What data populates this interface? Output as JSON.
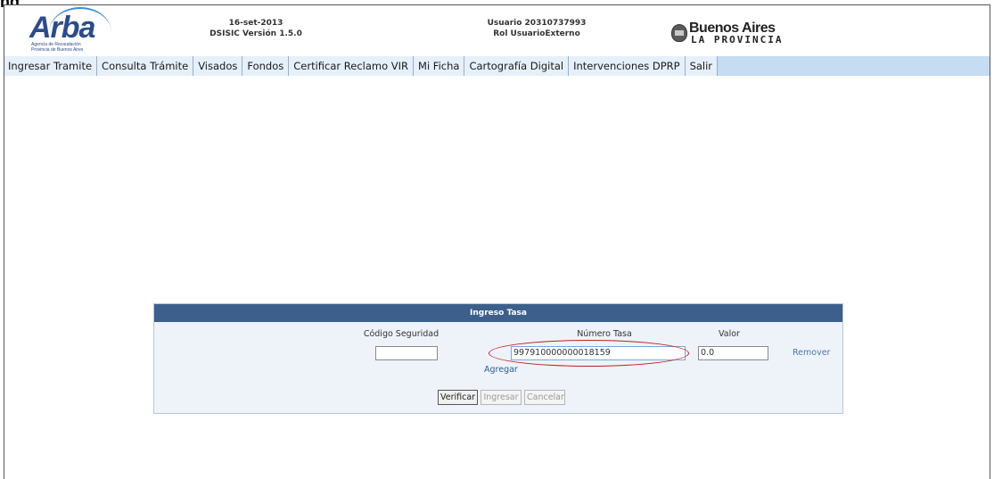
{
  "page_title": "ng",
  "header": {
    "logo": {
      "word": "Arba",
      "subtext_line1": "Agencia de Recaudación",
      "subtext_line2": "Provincia de Buenos Aires"
    },
    "date": "16-set-2013",
    "version": "DSISIC Versión 1.5.0",
    "user": "Usuario 20310737993",
    "role": "Rol UsuarioExterno",
    "province_logo": {
      "top": "Buenos Aires",
      "bottom": "LA PROVINCIA"
    }
  },
  "menu": {
    "items": [
      {
        "label": "Ingresar Tramite"
      },
      {
        "label": "Consulta Trámite"
      },
      {
        "label": "Visados"
      },
      {
        "label": "Fondos"
      },
      {
        "label": "Certificar Reclamo VIR"
      },
      {
        "label": "Mi Ficha"
      },
      {
        "label": "Cartografía Digital"
      },
      {
        "label": "Intervenciones DPRP"
      },
      {
        "label": "Salir"
      }
    ]
  },
  "panel": {
    "title": "Ingreso Tasa",
    "labels": {
      "codigo": "Código Seguridad",
      "numero": "Número Tasa",
      "valor": "Valor"
    },
    "fields": {
      "codigo": "",
      "numero": "997910000000018159",
      "valor": "0.0"
    },
    "remove_link": "Remover",
    "add_link": "Agregar",
    "buttons": {
      "verificar": "Verificar",
      "ingresar": "Ingresar",
      "cancelar": "Cancelar"
    }
  },
  "colors": {
    "menu_bar": "#c5dcf2",
    "panel_header": "#3c5f8b",
    "highlight": "#c81e1e",
    "link": "#2b5d99"
  }
}
